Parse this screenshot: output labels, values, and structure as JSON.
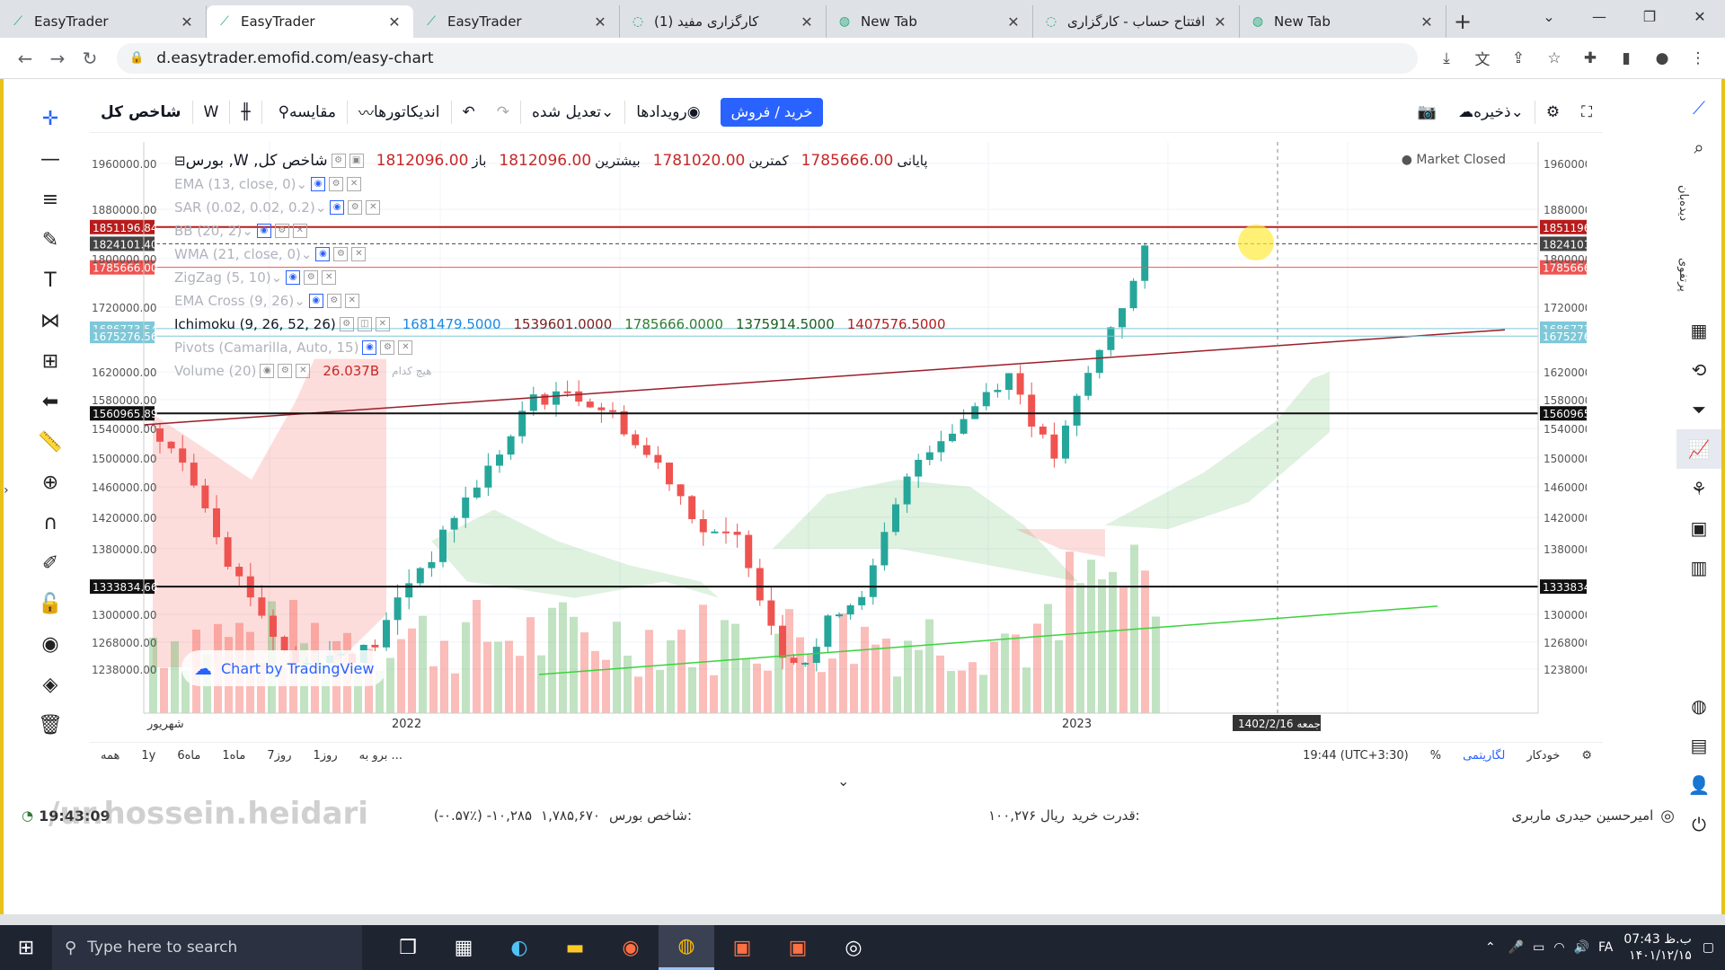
{
  "browser": {
    "tabs": [
      {
        "label": "EasyTrader",
        "active": false
      },
      {
        "label": "EasyTrader",
        "active": true
      },
      {
        "label": "EasyTrader",
        "active": false
      },
      {
        "label": "کارگزاری مفید (1)",
        "active": false
      },
      {
        "label": "New Tab",
        "active": false
      },
      {
        "label": "افتتاح حساب - کارگزاری",
        "active": false
      },
      {
        "label": "New Tab",
        "active": false
      }
    ],
    "url": "d.easytrader.emofid.com/easy-chart"
  },
  "toolbar": {
    "symbol": "شاخص کل",
    "interval": "W",
    "compare": "مقایسه",
    "indicators": "اندیکاتورها",
    "adjusted": "تعدیل شده",
    "events": "رویدادها",
    "buysell": "خرید / فروش",
    "save": "ذخیره"
  },
  "legend": {
    "title": "بورس ,W ,شاخص کل",
    "open_label": "باز",
    "open": "1812096.00",
    "high_label": "بیشترین",
    "high": "1812096.00",
    "low_label": "کمترین",
    "low": "1781020.00",
    "close_label": "پایانی",
    "close": "1785666.00",
    "indicators": [
      {
        "name": "EMA (13, close, 0)",
        "muted": true
      },
      {
        "name": "SAR (0.02, 0.02, 0.2)",
        "muted": true
      },
      {
        "name": "BB (20, 2)",
        "muted": true
      },
      {
        "name": "WMA (21, close, 0)",
        "muted": true
      },
      {
        "name": "ZigZag (5, 10)",
        "muted": true
      },
      {
        "name": "EMA Cross (9, 26)",
        "muted": true
      }
    ],
    "ichimoku": {
      "name": "Ichimoku (9, 26, 52, 26)",
      "values": [
        "1681479.5000",
        "1539601.0000",
        "1785666.0000",
        "1375914.5000",
        "1407576.5000"
      ]
    },
    "pivots": "Pivots (Camarilla, Auto, 15)",
    "volume": {
      "name": "Volume (20)",
      "value": "26.037B",
      "extra": "هیچ کدام"
    }
  },
  "market_status": "Market Closed",
  "tv_badge": "Chart by TradingView",
  "chart_data": {
    "type": "candlestick",
    "y_ticks": [
      "1960000.00",
      "1880000.00",
      "1800000.00",
      "1720000.00",
      "1620000.00",
      "1580000.00",
      "1540000.00",
      "1500000.00",
      "1460000.00",
      "1420000.00",
      "1380000.00",
      "1300000.00",
      "1268000.00",
      "1238000.00"
    ],
    "left_tags": [
      {
        "value": "1851196.84",
        "color": "#b71c1c"
      },
      {
        "value": "1824101.40",
        "color": "#444444"
      },
      {
        "value": "1785666.00",
        "color": "#ef5350"
      },
      {
        "value": "1686773.54",
        "color": "#7ec8d8"
      },
      {
        "value": "1675276.56",
        "color": "#7ec8d8"
      },
      {
        "value": "1560965.89",
        "color": "#111111"
      },
      {
        "value": "1333834.66",
        "color": "#111111"
      }
    ],
    "x_labels": [
      "شهریور",
      "2022",
      "2023"
    ],
    "crosshair_date": "1402/2/16 جمعه",
    "ylim": [
      1215000,
      1985000
    ]
  },
  "bottom": {
    "ranges": [
      "همه",
      "1y",
      "6ماه",
      "1ماه",
      "7روز",
      "1روز",
      "برو به ..."
    ],
    "time": "19:44 (UTC+3:30)",
    "percent": "%",
    "log": "لگاریتمی",
    "auto": "خودکار"
  },
  "status": {
    "clock": "19:43:09",
    "watermark": "/ur.hossein.heidari",
    "index_label": "شاخص بورس:",
    "index_value": "۱,۷۸۵,۶۷۰",
    "index_change": "(-۰.۵۷٪) -۱۰,۲۸۵",
    "buying_power_label": "قدرت خرید:",
    "buying_power": "۱۰۰,۲۷۶ ریال",
    "user": "امیرحسین حیدری ماربری"
  },
  "taskbar": {
    "search_placeholder": "Type here to search",
    "lang": "FA",
    "time": "07:43 ب.ظ",
    "date": "۱۴۰۱/۱۲/۱۵"
  }
}
